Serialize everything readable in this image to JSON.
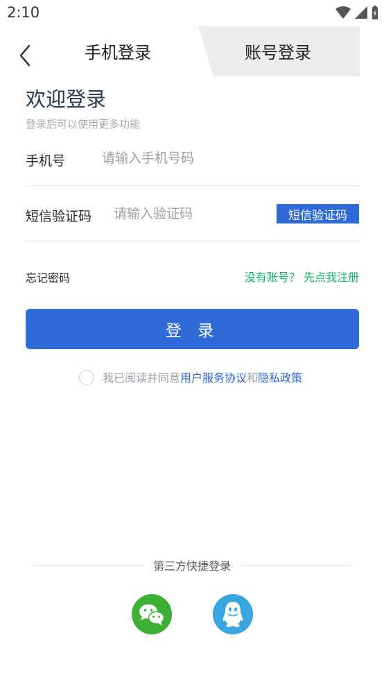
{
  "status": {
    "time": "2:10"
  },
  "header": {
    "tab_phone": "手机登录",
    "tab_account": "账号登录"
  },
  "welcome": {
    "title": "欢迎登录",
    "subtitle": "登录后可以使用更多功能"
  },
  "form": {
    "phone_label": "手机号",
    "phone_placeholder": "请输入手机号码",
    "code_label": "短信验证码",
    "code_placeholder": "请输入验证码",
    "sms_button": "短信验证码"
  },
  "links": {
    "forgot": "忘记密码",
    "register": "没有账号？ 先点我注册"
  },
  "login_button": "登 录",
  "agreement": {
    "prefix": "我已阅读并同意",
    "service": "用户服务协议",
    "and": "和",
    "privacy": "隐私政策"
  },
  "third_party": {
    "title": "第三方快捷登录",
    "icons": [
      "wechat-icon",
      "qq-icon"
    ]
  },
  "colors": {
    "primary": "#2f6bd6",
    "green_link": "#19b26b",
    "wechat": "#3cb034",
    "qq": "#3aa6e0"
  }
}
